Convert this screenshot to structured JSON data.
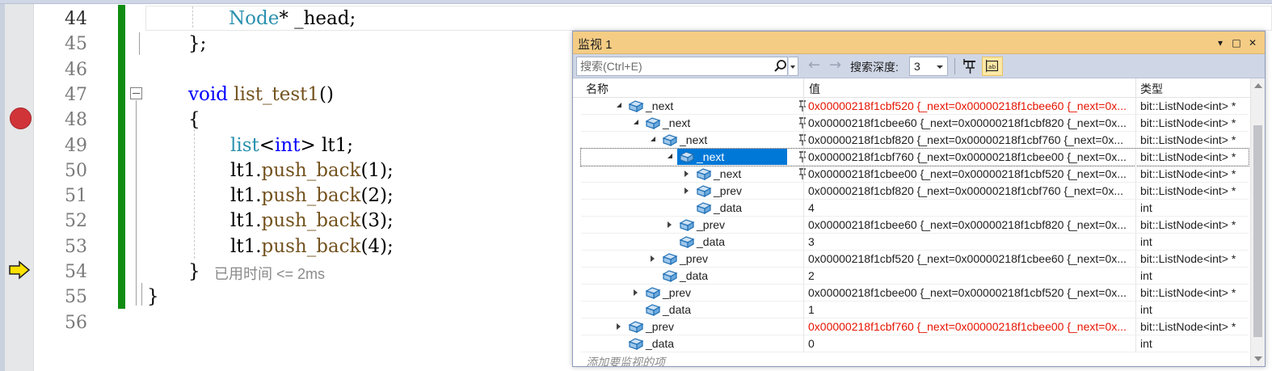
{
  "editor": {
    "lines": [
      {
        "num": "44",
        "tokens": [
          {
            "t": "Node",
            "c": "tp"
          },
          {
            "t": "* _head;",
            "c": ""
          }
        ]
      },
      {
        "num": "45",
        "tokens": [
          {
            "t": "};",
            "c": ""
          }
        ]
      },
      {
        "num": "46",
        "tokens": []
      },
      {
        "num": "47",
        "tokens": [
          {
            "t": "void",
            "c": "kw"
          },
          {
            "t": " ",
            "c": ""
          },
          {
            "t": "list_test1",
            "c": "fn"
          },
          {
            "t": "()",
            "c": ""
          }
        ]
      },
      {
        "num": "48",
        "tokens": [
          {
            "t": "{",
            "c": ""
          }
        ]
      },
      {
        "num": "49",
        "tokens": [
          {
            "t": "list",
            "c": "tp"
          },
          {
            "t": "<",
            "c": ""
          },
          {
            "t": "int",
            "c": "kw"
          },
          {
            "t": "> lt1;",
            "c": ""
          }
        ]
      },
      {
        "num": "50",
        "tokens": [
          {
            "t": "lt1.",
            "c": ""
          },
          {
            "t": "push_back",
            "c": "fn"
          },
          {
            "t": "(1);",
            "c": ""
          }
        ]
      },
      {
        "num": "51",
        "tokens": [
          {
            "t": "lt1.",
            "c": ""
          },
          {
            "t": "push_back",
            "c": "fn"
          },
          {
            "t": "(2);",
            "c": ""
          }
        ]
      },
      {
        "num": "52",
        "tokens": [
          {
            "t": "lt1.",
            "c": ""
          },
          {
            "t": "push_back",
            "c": "fn"
          },
          {
            "t": "(3);",
            "c": ""
          }
        ]
      },
      {
        "num": "53",
        "tokens": [
          {
            "t": "lt1.",
            "c": ""
          },
          {
            "t": "push_back",
            "c": "fn"
          },
          {
            "t": "(4);",
            "c": ""
          }
        ]
      },
      {
        "num": "54",
        "tokens": [
          {
            "t": "}",
            "c": ""
          }
        ]
      },
      {
        "num": "55",
        "tokens": [
          {
            "t": "}",
            "c": ""
          }
        ]
      },
      {
        "num": "56",
        "tokens": []
      }
    ],
    "perf_tip": "已用时间 <= 2ms"
  },
  "watch": {
    "title": "监视 1",
    "search_placeholder": "搜索(Ctrl+E)",
    "depth_label": "搜索深度:",
    "depth_value": "3",
    "columns": {
      "name": "名称",
      "value": "值",
      "type": "类型"
    },
    "rows": [
      {
        "name": "_next",
        "level": 3,
        "exp": "open",
        "pin": true,
        "value": "0x00000218f1cbf520 {_next=0x00000218f1cbee60 {_next=0x...",
        "type": "bit::ListNode<int> *",
        "changed": true
      },
      {
        "name": "_next",
        "level": 4,
        "exp": "open",
        "pin": true,
        "value": "0x00000218f1cbee60 {_next=0x00000218f1cbf820 {_next=0x...",
        "type": "bit::ListNode<int> *",
        "changed": false
      },
      {
        "name": "_next",
        "level": 5,
        "exp": "open",
        "pin": true,
        "value": "0x00000218f1cbf820 {_next=0x00000218f1cbf760 {_next=0x...",
        "type": "bit::ListNode<int> *",
        "changed": false
      },
      {
        "name": "_next",
        "level": 6,
        "exp": "open",
        "pin": true,
        "value": "0x00000218f1cbf760 {_next=0x00000218f1cbee00 {_next=0x...",
        "type": "bit::ListNode<int> *",
        "changed": false,
        "selected": true
      },
      {
        "name": "_next",
        "level": 7,
        "exp": "closed",
        "pin": true,
        "value": "0x00000218f1cbee00 {_next=0x00000218f1cbf520 {_next=0x...",
        "type": "bit::ListNode<int> *",
        "changed": false
      },
      {
        "name": "_prev",
        "level": 7,
        "exp": "closed",
        "pin": false,
        "value": "0x00000218f1cbf820 {_next=0x00000218f1cbf760 {_next=0x...",
        "type": "bit::ListNode<int> *",
        "changed": false
      },
      {
        "name": "_data",
        "level": 7,
        "exp": "none",
        "pin": false,
        "value": "4",
        "type": "int",
        "changed": false
      },
      {
        "name": "_prev",
        "level": 6,
        "exp": "closed",
        "pin": false,
        "value": "0x00000218f1cbee60 {_next=0x00000218f1cbf820 {_next=0x...",
        "type": "bit::ListNode<int> *",
        "changed": false
      },
      {
        "name": "_data",
        "level": 6,
        "exp": "none",
        "pin": false,
        "value": "3",
        "type": "int",
        "changed": false
      },
      {
        "name": "_prev",
        "level": 5,
        "exp": "closed",
        "pin": false,
        "value": "0x00000218f1cbf520 {_next=0x00000218f1cbee60 {_next=0x...",
        "type": "bit::ListNode<int> *",
        "changed": false
      },
      {
        "name": "_data",
        "level": 5,
        "exp": "none",
        "pin": false,
        "value": "2",
        "type": "int",
        "changed": false
      },
      {
        "name": "_prev",
        "level": 4,
        "exp": "closed",
        "pin": false,
        "value": "0x00000218f1cbee00 {_next=0x00000218f1cbf520 {_next=0x...",
        "type": "bit::ListNode<int> *",
        "changed": false
      },
      {
        "name": "_data",
        "level": 4,
        "exp": "none",
        "pin": false,
        "value": "1",
        "type": "int",
        "changed": false
      },
      {
        "name": "_prev",
        "level": 3,
        "exp": "closed",
        "pin": false,
        "value": "0x00000218f1cbf760 {_next=0x00000218f1cbee00 {_next=0x...",
        "type": "bit::ListNode<int> *",
        "changed": true
      },
      {
        "name": "_data",
        "level": 3,
        "exp": "none",
        "pin": false,
        "value": "0",
        "type": "int",
        "changed": false
      }
    ],
    "add_watch": "添加要监视的项"
  },
  "colors": {
    "accent_selected": "#0078d7",
    "changed_value": "#e51400",
    "breakpoint": "#d13438",
    "change_bar": "#108d10",
    "title_bar": "#f5cc84"
  }
}
